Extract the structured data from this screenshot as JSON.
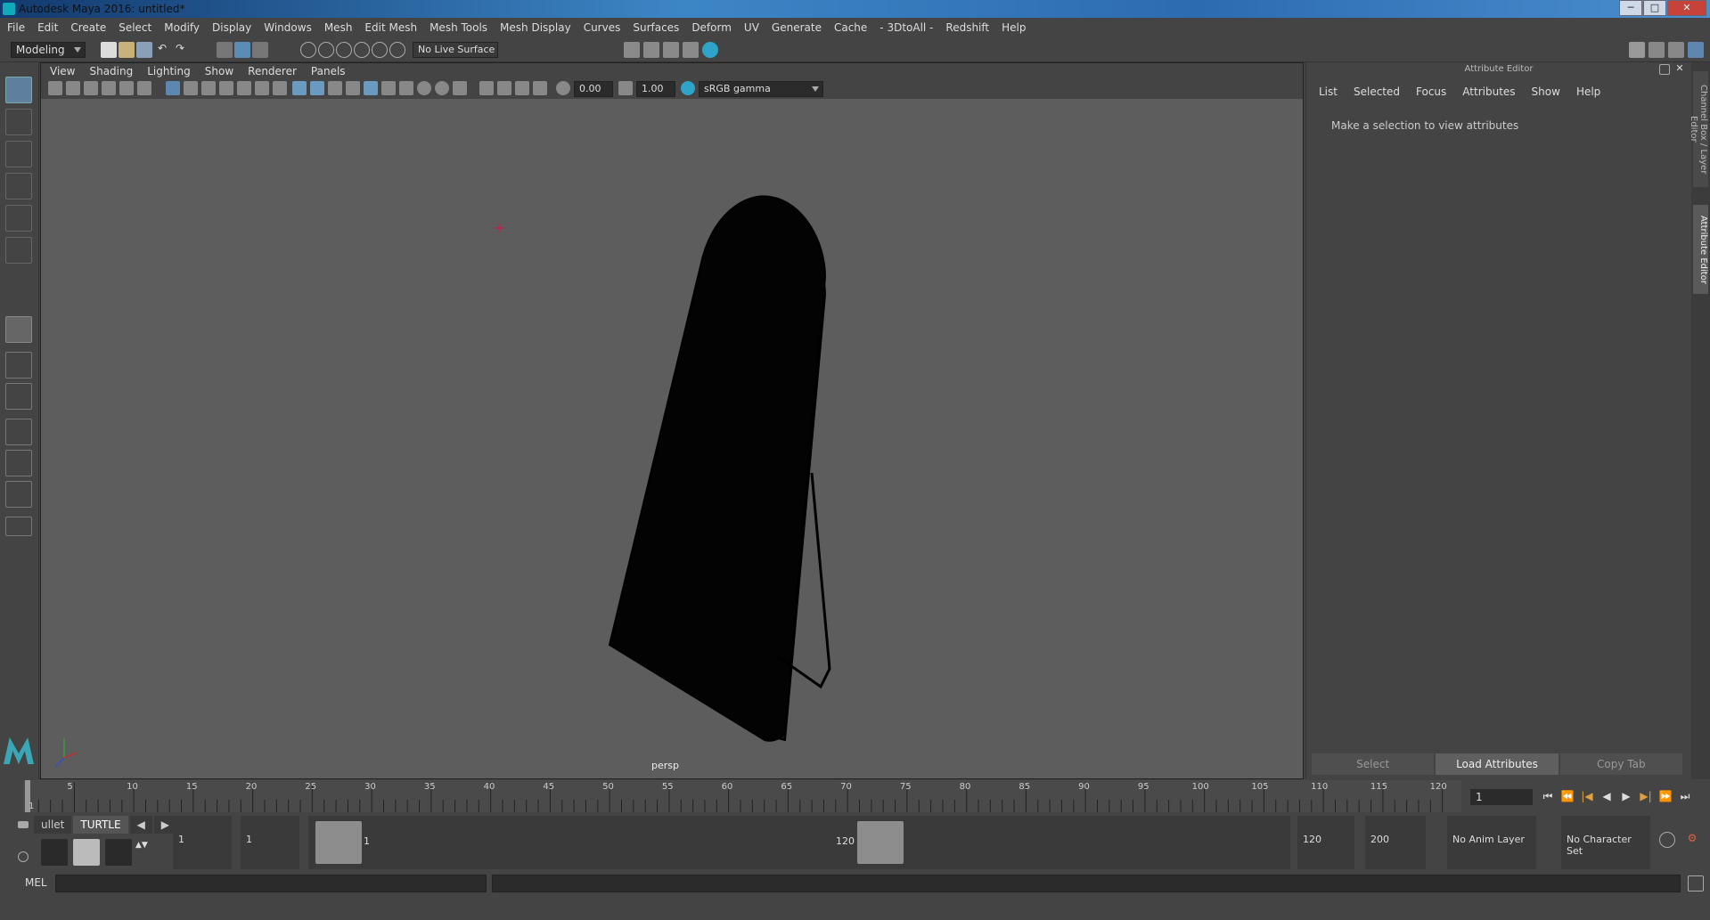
{
  "window": {
    "title": "Autodesk Maya 2016: untitled*",
    "min": "─",
    "max": "□",
    "close": "✕"
  },
  "menu": [
    "File",
    "Edit",
    "Create",
    "Select",
    "Modify",
    "Display",
    "Windows",
    "Mesh",
    "Edit Mesh",
    "Mesh Tools",
    "Mesh Display",
    "Curves",
    "Surfaces",
    "Deform",
    "UV",
    "Generate",
    "Cache",
    "- 3DtoAll -",
    "Redshift",
    "Help"
  ],
  "status": {
    "mode": "Modeling",
    "live_surface": "No Live Surface"
  },
  "panel_menu": [
    "View",
    "Shading",
    "Lighting",
    "Show",
    "Renderer",
    "Panels"
  ],
  "panel_bar": {
    "exposure": "0.00",
    "gamma": "1.00",
    "color_space": "sRGB gamma"
  },
  "viewport": {
    "camera": "persp"
  },
  "attr_editor": {
    "title": "Attribute Editor",
    "tabs": [
      "List",
      "Selected",
      "Focus",
      "Attributes",
      "Show",
      "Help"
    ],
    "message": "Make a selection to view attributes",
    "buttons": [
      "Select",
      "Load Attributes",
      "Copy Tab"
    ]
  },
  "side_tabs": [
    "Channel Box / Layer Editor",
    "Attribute Editor"
  ],
  "timeline": {
    "tick_labels": [
      "5",
      "10",
      "15",
      "20",
      "25",
      "30",
      "35",
      "40",
      "45",
      "50",
      "55",
      "60",
      "65",
      "70",
      "75",
      "80",
      "85",
      "90",
      "95",
      "100",
      "105",
      "110",
      "115",
      "120"
    ],
    "start_label": "1",
    "current_frame": "1"
  },
  "shelf_tabs": [
    "ullet",
    "TURTLE"
  ],
  "range": {
    "start": "1",
    "playback_start": "1",
    "handle_start_label": "1",
    "handle_end_label": "120",
    "playback_end": "120",
    "end": "200",
    "anim_layer": "No Anim Layer",
    "character_set": "No Character Set"
  },
  "cmd": {
    "label": "MEL"
  }
}
